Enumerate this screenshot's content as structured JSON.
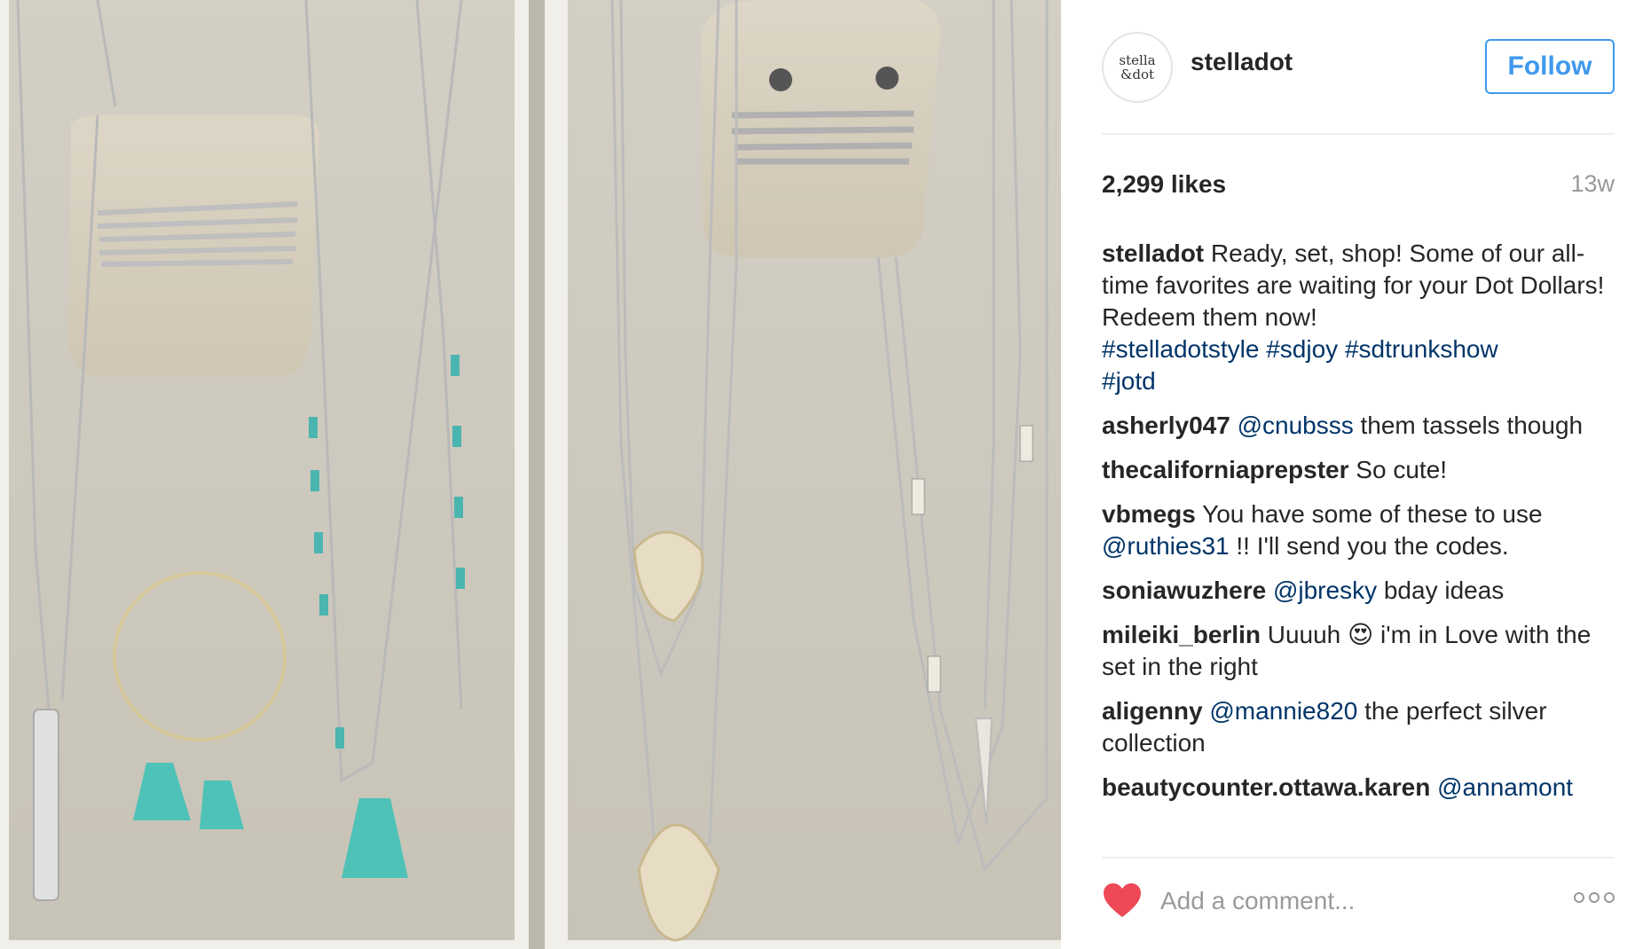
{
  "post": {
    "image_alt": "Jewelry display trays with bracelets and necklaces",
    "avatar": {
      "line1": "stella",
      "line2": "&dot"
    },
    "username": "stelladot",
    "follow_label": "Follow",
    "likes": "2,299 likes",
    "age": "13w"
  },
  "caption": {
    "user": "stelladot",
    "text": " Ready, set, shop! Some of our all-time favorites are waiting for your Dot Dollars! Redeem them now!",
    "tags": [
      "#stelladotstyle",
      "#sdjoy",
      "#sdtrunkshow",
      "#jotd"
    ]
  },
  "comments": [
    {
      "user": "asherly047",
      "mention": "@cnubsss",
      "text": " them tassels though"
    },
    {
      "user": "thecaliforniaprepster",
      "mention": "",
      "text": " So cute!"
    },
    {
      "user": "vbmegs",
      "pre": " You have some of these to use ",
      "mention": "@ruthies31",
      "text": " !! I'll send you the codes."
    },
    {
      "user": "soniawuzhere",
      "mention": "@jbresky",
      "text": " bday ideas"
    },
    {
      "user": "mileiki_berlin",
      "pre": " Uuuuh ",
      "emoji": "😍",
      "mention": "",
      "text": " i'm in Love with the set in the right"
    },
    {
      "user": "aligenny",
      "mention": "@mannie820",
      "text": " the perfect silver collection"
    },
    {
      "user": "beautycounter.ottawa.karen",
      "mention": "@annamont",
      "text": ""
    }
  ],
  "footer": {
    "comment_placeholder": "Add a comment...",
    "heart_icon": "heart-icon",
    "more_icon": "more-options-icon"
  },
  "colors": {
    "link": "#003569",
    "follow_blue": "#3f99ed",
    "heart_red": "#ed4956",
    "muted": "#999999"
  }
}
